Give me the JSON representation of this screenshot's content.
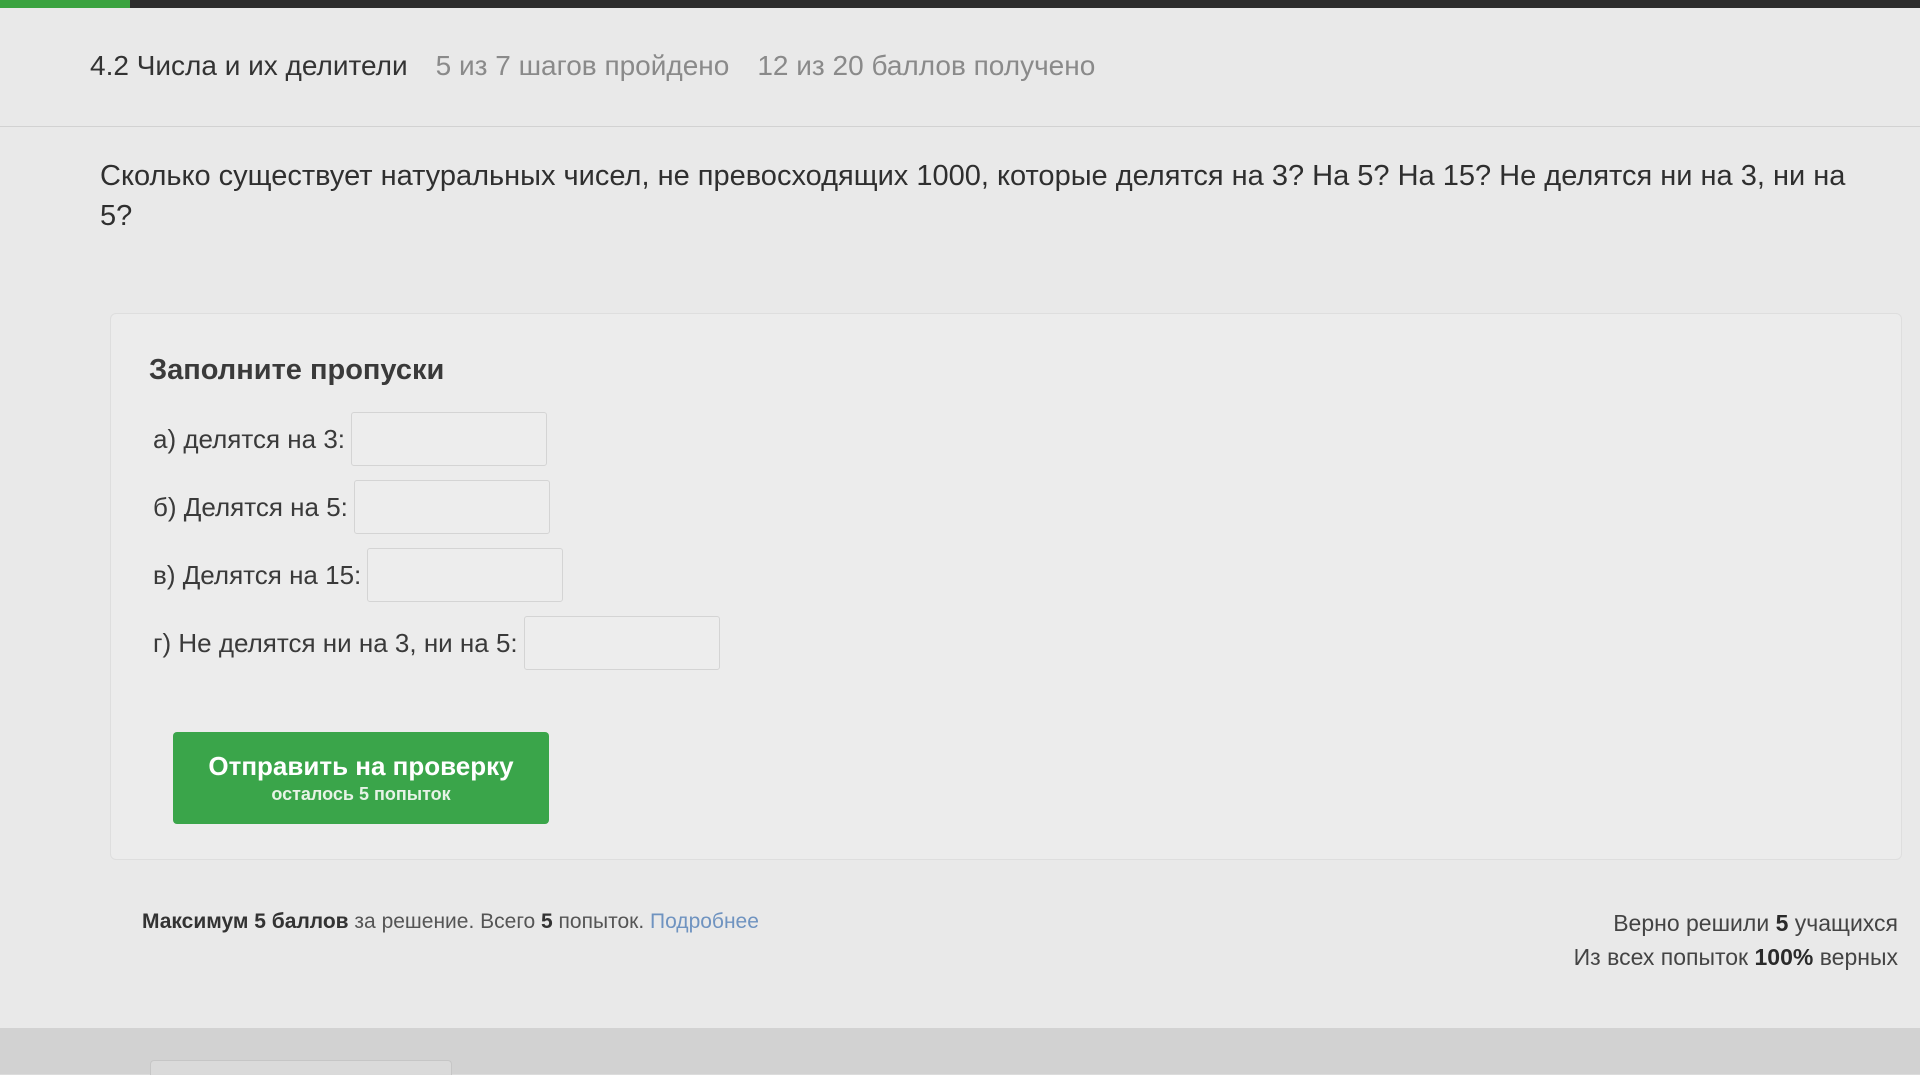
{
  "header": {
    "lesson_title": "4.2 Числа и их делители",
    "steps_progress": "5 из 7 шагов пройдено",
    "score_progress": "12 из 20 баллов  получено"
  },
  "question": {
    "text": "Сколько существует натуральных чисел, не превосходящих 1000, которые делятся на 3? На 5? На 15? Не делятся ни на 3, ни на 5?"
  },
  "quiz": {
    "title": "Заполните пропуски",
    "fields": [
      {
        "label": "а) делятся на 3:",
        "value": ""
      },
      {
        "label": "б) Делятся на 5:",
        "value": ""
      },
      {
        "label": "в) Делятся на 15:",
        "value": ""
      },
      {
        "label": "г) Не делятся ни на 3, ни на 5:",
        "value": ""
      }
    ],
    "submit_label": "Отправить на проверку",
    "attempts_left": "осталось 5 попыток"
  },
  "footer": {
    "max_prefix": "Максимум 5 баллов",
    "max_middle": " за решение. Всего ",
    "attempts_count": "5",
    "attempts_suffix": " попыток. ",
    "more_link": "Подробнее",
    "solved_prefix": "Верно решили ",
    "solved_count": "5",
    "solved_suffix": " учащихся",
    "success_prefix": "Из всех попыток ",
    "success_percent": "100%",
    "success_suffix": " верных"
  },
  "colors": {
    "accent_green": "#3aa54a",
    "link_blue": "#6f93c0"
  }
}
